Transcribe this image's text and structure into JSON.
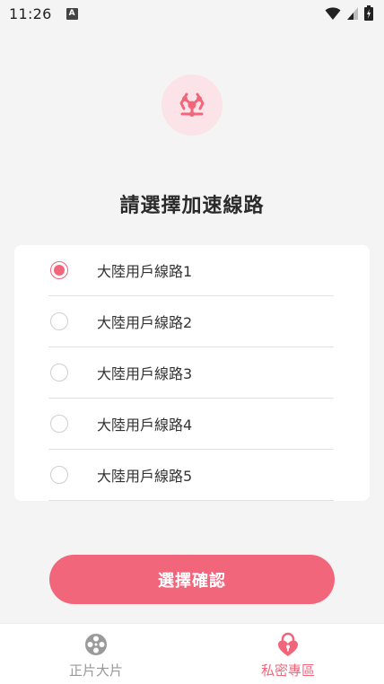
{
  "status_bar": {
    "time": "11:26",
    "a_badge": "A"
  },
  "heading": "請選擇加速線路",
  "routes": [
    {
      "label": "大陸用戶線路1",
      "selected": true
    },
    {
      "label": "大陸用戶線路2",
      "selected": false
    },
    {
      "label": "大陸用戶線路3",
      "selected": false
    },
    {
      "label": "大陸用戶線路4",
      "selected": false
    },
    {
      "label": "大陸用戶線路5",
      "selected": false
    }
  ],
  "confirm_label": "選擇確認",
  "nav": {
    "items": [
      {
        "label": "正片大片",
        "icon": "film-reel-icon",
        "active": false
      },
      {
        "label": "私密專區",
        "icon": "lock-heart-icon",
        "active": true
      }
    ]
  },
  "colors": {
    "accent": "#f2667c",
    "accent_light": "#fbe3e7",
    "inactive": "#999999"
  }
}
